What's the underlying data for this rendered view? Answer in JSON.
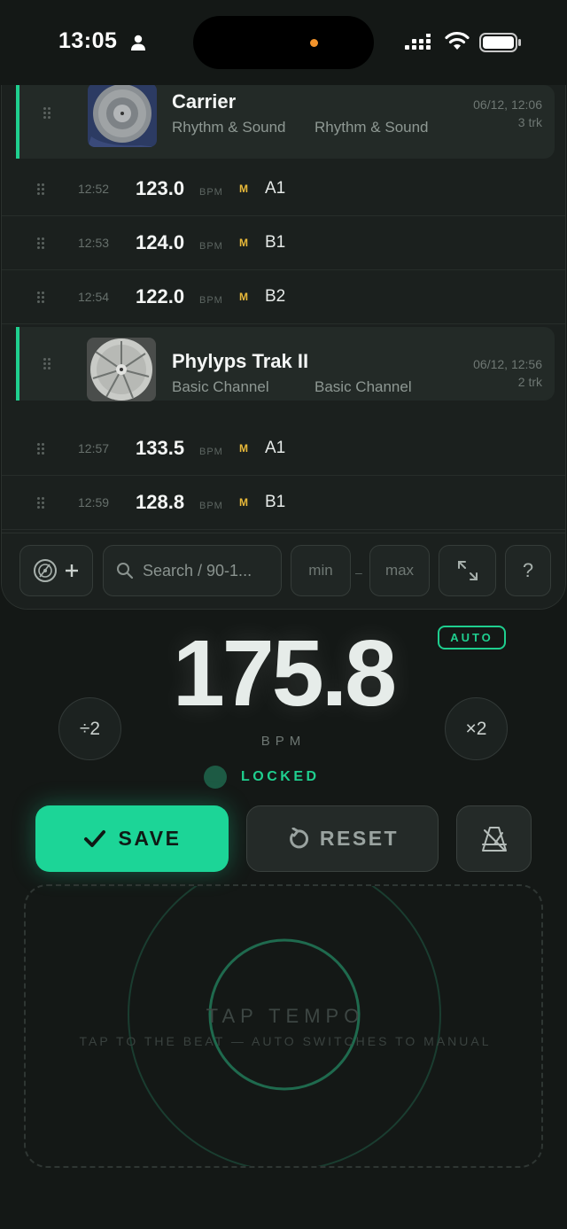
{
  "status_bar": {
    "time": "13:05"
  },
  "colors": {
    "accent": "#1cd597",
    "key_marker": "#e8b93a",
    "background": "#141816"
  },
  "list": {
    "groups": [
      {
        "title": "Carrier",
        "artist": "Rhythm & Sound",
        "album_artist": "Rhythm & Sound",
        "date": "06/12, 12:06",
        "count": "3 trk"
      },
      {
        "title": "Phylyps Trak II",
        "artist": "Basic Channel",
        "album_artist": "Basic Channel",
        "date": "06/12, 12:56",
        "count": "2 trk"
      }
    ],
    "tracks": [
      {
        "time": "12:52",
        "bpm": "123.0",
        "unit": "BPM",
        "marker": "M",
        "key": "A1"
      },
      {
        "time": "12:53",
        "bpm": "124.0",
        "unit": "BPM",
        "marker": "M",
        "key": "B1"
      },
      {
        "time": "12:54",
        "bpm": "122.0",
        "unit": "BPM",
        "marker": "M",
        "key": "B2"
      },
      {
        "time": "12:57",
        "bpm": "133.5",
        "unit": "BPM",
        "marker": "M",
        "key": "A1"
      },
      {
        "time": "12:59",
        "bpm": "128.8",
        "unit": "BPM",
        "marker": "M",
        "key": "B1"
      }
    ]
  },
  "toolbar": {
    "search_placeholder": "Search / 90-1...",
    "min_label": "min",
    "dash": "–",
    "max_label": "max",
    "help_label": "?"
  },
  "tempo": {
    "mode_badge": "AUTO",
    "bpm": "175.8",
    "bpm_label": "BPM",
    "half_label": "÷2",
    "double_label": "×2",
    "lock_status": "LOCKED"
  },
  "actions": {
    "save_label": "SAVE",
    "reset_label": "RESET"
  },
  "tap": {
    "title": "TAP TEMPO",
    "subtitle": "TAP TO THE BEAT — AUTO SWITCHES TO MANUAL"
  }
}
